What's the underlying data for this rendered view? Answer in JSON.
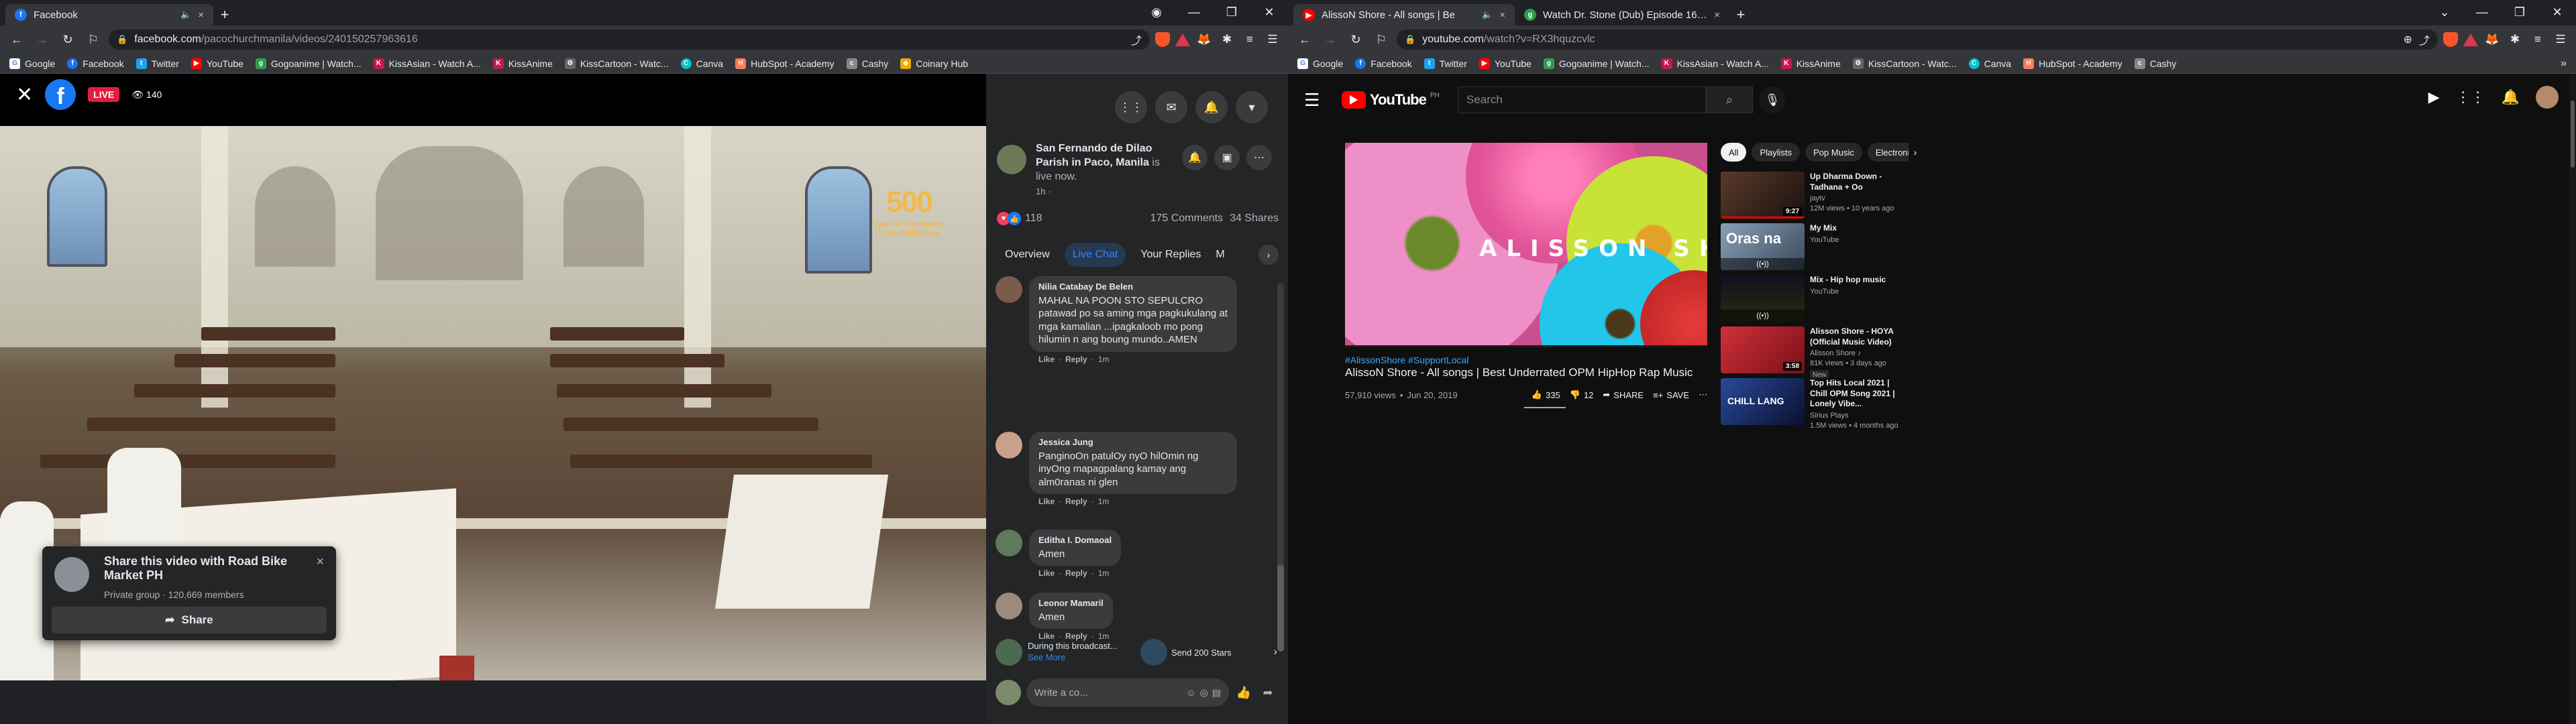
{
  "left": {
    "tabs": [
      {
        "title": "Facebook",
        "close": "×"
      }
    ],
    "new_tab": "+",
    "url": {
      "host": "facebook.com",
      "path": "/pacochurchmanila/videos/240150257963616"
    },
    "bookmarks": [
      "Google",
      "Facebook",
      "Twitter",
      "YouTube",
      "Gogoanime | Watch...",
      "KissAsian - Watch A...",
      "KissAnime",
      "KissCartoon - Watc...",
      "Canva",
      "HubSpot - Academy",
      "Cashy",
      "Coinary Hub"
    ],
    "video": {
      "live_label": "LIVE",
      "viewers": "140",
      "watermark": "Years of Christianity in the Philippines"
    },
    "share_popup": {
      "title": "Share this video with Road Bike Market PH",
      "subtitle": "Private group · 120,669 members",
      "button": "Share",
      "close": "×"
    },
    "post": {
      "page_name": "San Fernando de Dilao Parish in Paco, Manila",
      "status": "is live now.",
      "time": "1h ·",
      "reaction_count": "118",
      "comments": "175 Comments",
      "shares": "34 Shares"
    },
    "tabs_fb": [
      "Overview",
      "Live Chat",
      "Your Replies",
      "M"
    ],
    "comments": [
      {
        "name": "Nilia Catabay De Belen",
        "text": "MAHAL NA POON STO SEPULCRO patawad po sa aming mga pagkukulang at mga kamalian ...ipagkaloob mo pong hilumin n ang boung mundo..AMEN",
        "like": "Like",
        "reply": "Reply",
        "time": "1m",
        "color": "#7b5b4b"
      },
      {
        "name": "Jessica Jung",
        "text": "PanginoOn patulOy nyO hilOmin ng inyOng mapagpalang kamay ang alm0ranas ni glen",
        "like": "Like",
        "reply": "Reply",
        "time": "1m",
        "color": "#c9a08a"
      },
      {
        "name": "Editha I. Domaoal",
        "text": "Amen",
        "like": "Like",
        "reply": "Reply",
        "time": "1m",
        "color": "#5f7a5a"
      },
      {
        "name": "Leonor Mamaril",
        "text": "Amen",
        "like": "Like",
        "reply": "Reply",
        "time": "1m",
        "color": "#9c8a7a"
      }
    ],
    "during": {
      "text": "During this broadcast...",
      "link": "See More",
      "stars": "Send 200 Stars"
    },
    "write_placeholder": "Write a co..."
  },
  "right": {
    "tabs": [
      {
        "title": "AlissoN Shore - All songs | Be",
        "close": "×"
      },
      {
        "title": "Watch Dr. Stone (Dub) Episode 16 at",
        "close": "×"
      }
    ],
    "new_tab": "+",
    "url": {
      "host": "youtube.com",
      "path": "/watch?v=RX3hquzcvlc"
    },
    "bookmarks": [
      "Google",
      "Facebook",
      "Twitter",
      "YouTube",
      "Gogoanime | Watch...",
      "KissAsian - Watch A...",
      "KissAnime",
      "KissCartoon - Watc...",
      "Canva",
      "HubSpot - Academy",
      "Cashy"
    ],
    "masthead": {
      "logo": "YouTube",
      "region": "PH",
      "search_placeholder": "Search"
    },
    "video": {
      "overlay_text": "ALISSON SHORE",
      "hashtags": "#AlissonShore #SupportLocal",
      "title": "AlissoN Shore - All songs | Best Underrated OPM HipHop Rap Music",
      "views": "57,910 views",
      "date": "Jun 20, 2019",
      "likes": "335",
      "dislikes": "12",
      "share": "SHARE",
      "save": "SAVE"
    },
    "chips": [
      "All",
      "Playlists",
      "Pop Music",
      "Electronic Mus"
    ],
    "recs": [
      {
        "title": "Up Dharma Down - Tadhana + Oo",
        "channel": "jaytv",
        "meta": "12M views • 10 years ago",
        "duration": "9:27",
        "bg": "#3a2a22"
      },
      {
        "title": "My Mix",
        "channel": "YouTube",
        "meta": "",
        "duration": "",
        "mix": "Oras na",
        "bg": "#5a6a7a"
      },
      {
        "title": "Mix - Hip hop music",
        "channel": "YouTube",
        "meta": "",
        "duration": "",
        "bg": "#1c1c28"
      },
      {
        "title": "Alisson Shore - HOYA (Official Music Video)",
        "channel": "Alisson Shore ♪",
        "meta": "81K views • 3 days ago",
        "duration": "3:58",
        "badge": "New",
        "bg": "#a8202a"
      },
      {
        "title": "Top Hits Local 2021 | Chill OPM Song 2021 | Lonely Vibe...",
        "channel": "Sirius Plays",
        "meta": "1.5M views • 4 months ago",
        "duration": "",
        "mix": "CHILL LANG",
        "bg": "#1a2a5a"
      }
    ]
  }
}
